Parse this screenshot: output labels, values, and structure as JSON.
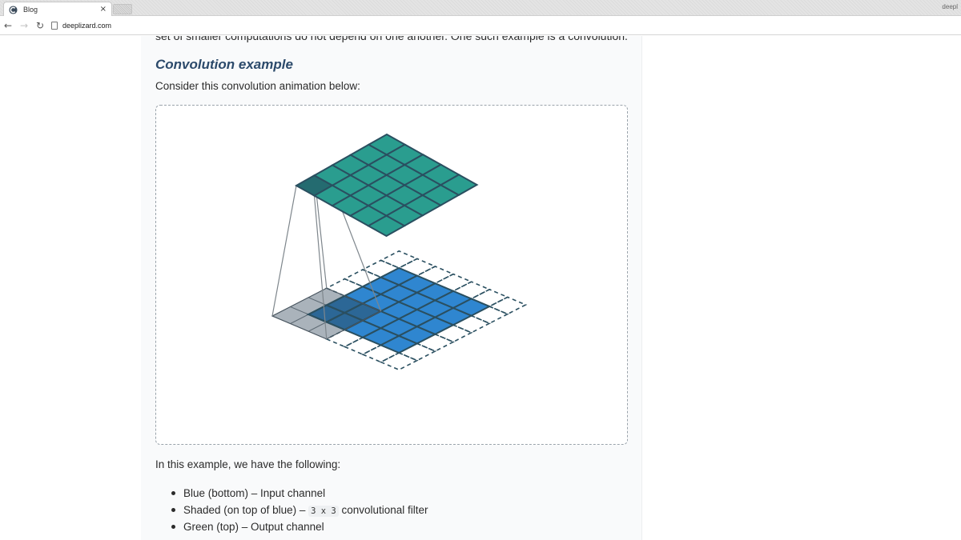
{
  "browser": {
    "tab_title": "Blog",
    "tab_close": "×",
    "profile_name": "deepl",
    "url": "deeplizard.com",
    "icons": {
      "favicon": "deeplizard-logo-icon",
      "back": "arrow-left-icon",
      "forward": "arrow-right-icon",
      "reload": "reload-icon",
      "page": "page-info-icon"
    }
  },
  "article": {
    "intro_line": "set of smaller computations do not depend on one another. One such example is a convolution.",
    "heading": "Convolution example",
    "lead": "Consider this convolution animation below:",
    "after_figure": "In this example, we have the following:",
    "bullets": [
      {
        "text": "Blue (bottom) – Input channel"
      },
      {
        "before": "Shaded (on top of blue) – ",
        "code": "3 x 3",
        "after": " convolutional filter"
      },
      {
        "text": "Green (top) – Output channel"
      }
    ]
  },
  "colors": {
    "heading": "#2c4a6b",
    "input_blue": "#2f86d0",
    "output_green": "#2a9d8f",
    "filter_gray": "#aab3bb",
    "grid_line": "#2a4f60"
  }
}
